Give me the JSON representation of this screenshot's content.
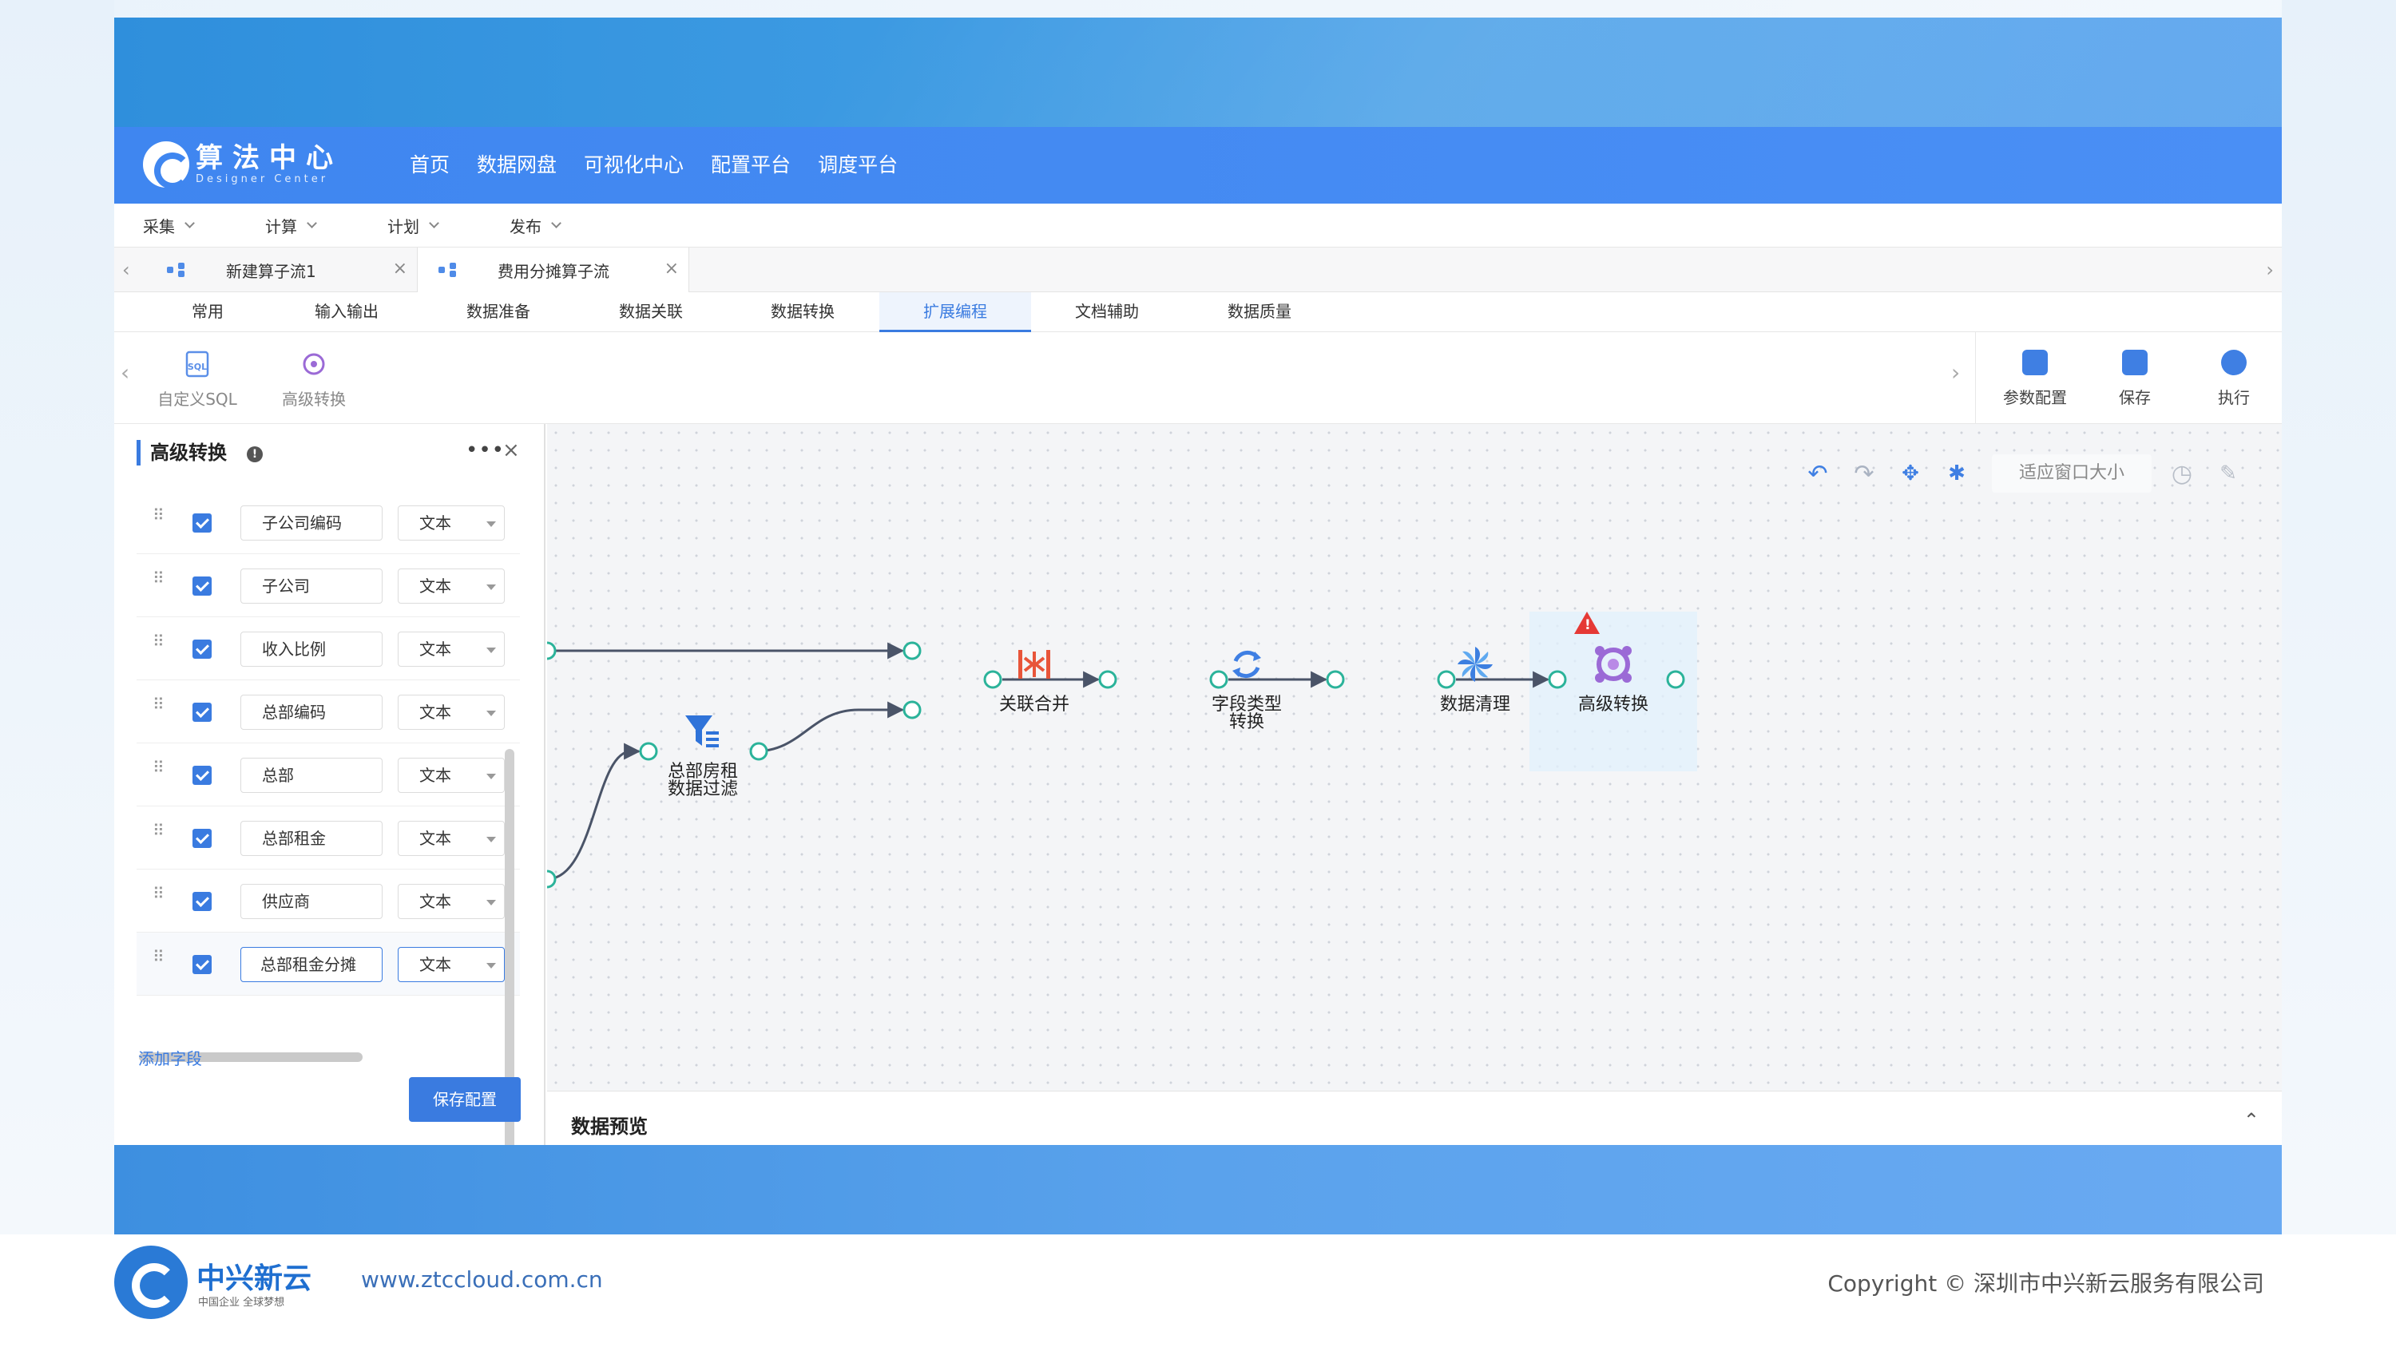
{
  "app": {
    "logo_cn": "算法中心",
    "logo_en": "Designer Center",
    "nav": [
      "首页",
      "数据网盘",
      "可视化中心",
      "配置平台",
      "调度平台"
    ]
  },
  "menubar": [
    "采集",
    "计算",
    "计划",
    "发布"
  ],
  "doc_tabs": [
    {
      "label": "新建算子流1",
      "active": false
    },
    {
      "label": "费用分摊算子流",
      "active": true
    }
  ],
  "category_tabs": [
    "常用",
    "输入输出",
    "数据准备",
    "数据关联",
    "数据转换",
    "扩展编程",
    "文档辅助",
    "数据质量"
  ],
  "active_category": "扩展编程",
  "tools": [
    {
      "label": "自定义SQL",
      "icon": "sql-icon"
    },
    {
      "label": "高级转换",
      "icon": "advanced-transform-icon"
    }
  ],
  "right_tools": [
    {
      "label": "参数配置",
      "icon": "params-config-icon"
    },
    {
      "label": "保存",
      "icon": "save-icon"
    },
    {
      "label": "执行",
      "icon": "run-icon"
    }
  ],
  "panel": {
    "title": "高级转换",
    "fields": [
      {
        "name": "子公司编码",
        "type": "文本",
        "checked": true
      },
      {
        "name": "子公司",
        "type": "文本",
        "checked": true
      },
      {
        "name": "收入比例",
        "type": "文本",
        "checked": true
      },
      {
        "name": "总部编码",
        "type": "文本",
        "checked": true
      },
      {
        "name": "总部",
        "type": "文本",
        "checked": true
      },
      {
        "name": "总部租金",
        "type": "文本",
        "checked": true
      },
      {
        "name": "供应商",
        "type": "文本",
        "checked": true
      },
      {
        "name": "总部租金分摊",
        "type": "文本",
        "checked": true
      }
    ],
    "add_field": "添加字段",
    "save_config": "保存配置"
  },
  "canvas": {
    "fit_window": "适应窗口大小",
    "toolbar_icons": [
      "undo-icon",
      "redo-icon",
      "move-icon",
      "debug-icon",
      "timer-icon",
      "tool-icon"
    ],
    "nodes": [
      {
        "id": "filter",
        "label1": "总部房租",
        "label2": "数据过滤",
        "icon": "filter-icon"
      },
      {
        "id": "join",
        "label1": "关联合并",
        "label2": "",
        "icon": "merge-icon"
      },
      {
        "id": "cast",
        "label1": "字段类型",
        "label2": "转换",
        "icon": "sync-icon"
      },
      {
        "id": "clean",
        "label1": "数据清理",
        "label2": "",
        "icon": "pinwheel-icon"
      },
      {
        "id": "advanced",
        "label1": "高级转换",
        "label2": "",
        "icon": "advanced-transform-icon",
        "warning": true
      }
    ]
  },
  "preview": {
    "title": "数据预览"
  },
  "footer": {
    "brand": "中兴新云",
    "slogan": "中国企业 全球梦想",
    "url": "www.ztccloud.com.cn",
    "copyright": "Copyright © 深圳市中兴新云服务有限公司"
  },
  "colors": {
    "primary": "#3a7be0",
    "header": "#3f86f0",
    "node_port": "#2bb39a",
    "warning": "#e53935",
    "merge": "#e8553a"
  }
}
